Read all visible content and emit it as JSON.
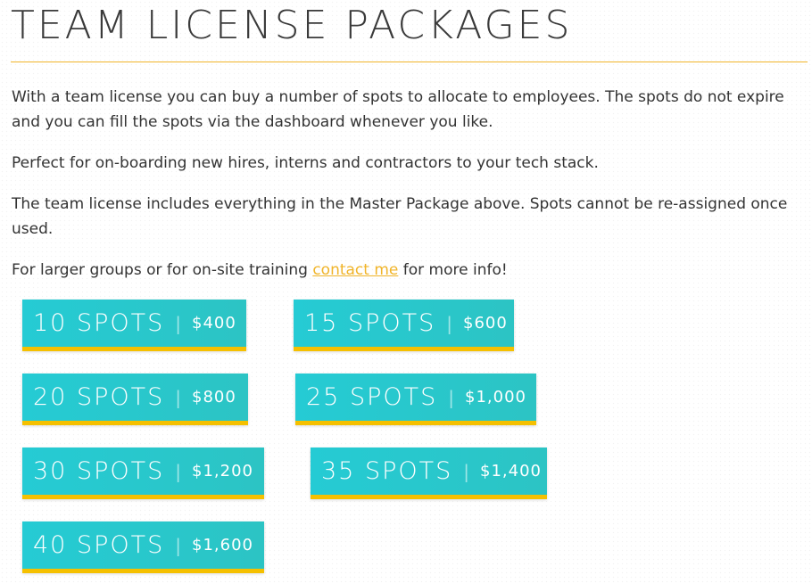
{
  "header": {
    "title": "TEAM LICENSE PACKAGES"
  },
  "intro": {
    "p1": "With a team license you can buy a number of spots to allocate to employees. The spots do not expire and you can fill the spots via the dashboard whenever you like.",
    "p2": "Perfect for on-boarding new hires, interns and contractors to your tech stack.",
    "p3": "The team license includes everything in the Master Package above. Spots cannot be re-assigned once used.",
    "p4_before": "For larger groups or for on-site training ",
    "p4_link": "contact me",
    "p4_after": " for more info!"
  },
  "packages": [
    {
      "spots": "10 SPOTS",
      "sep": "|",
      "price": "$400"
    },
    {
      "spots": "15 SPOTS",
      "sep": "|",
      "price": "$600"
    },
    {
      "spots": "20 SPOTS",
      "sep": "|",
      "price": "$800"
    },
    {
      "spots": "25 SPOTS",
      "sep": "|",
      "price": "$1,000"
    },
    {
      "spots": "30 SPOTS",
      "sep": "|",
      "price": "$1,200"
    },
    {
      "spots": "35 SPOTS",
      "sep": "|",
      "price": "$1,400"
    },
    {
      "spots": "40 SPOTS",
      "sep": "|",
      "price": "$1,600"
    }
  ],
  "colors": {
    "accent": "#f0b429",
    "button_bg": "#25cbd4",
    "button_border": "#f5c000",
    "text": "#333333"
  }
}
